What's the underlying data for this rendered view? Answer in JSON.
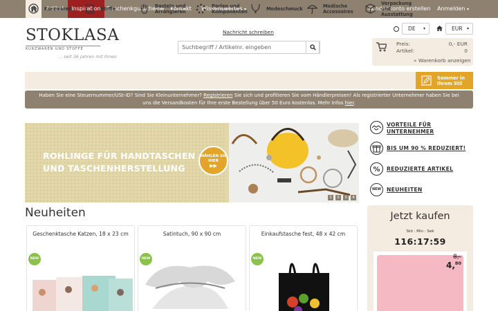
{
  "topnav": {
    "items": [
      "Artikel",
      "Inspiration",
      "Geschenkgutscheine",
      "Kontakt",
      "Wissenswertes"
    ],
    "account": "Kundenkonto erstellen",
    "login": "Anmelden"
  },
  "logo": {
    "word": "STOKLASA",
    "sub": "KURZWAREN UND STOFFE",
    "tagline": "... seit 36 Jahren mit Ihnen"
  },
  "header": {
    "message_link": "Nachricht schreiben",
    "search_placeholder": "Suchbegriff / Artikelnr. eingeben",
    "language": "DE",
    "currency": "EUR"
  },
  "cart": {
    "price_label": "Preis:",
    "price_value": "0,- EUR",
    "count_label": "Artikel:",
    "count_value": "0",
    "link": "» Warenkorb anzeigen"
  },
  "categories": [
    {
      "label": "Kurzwaren",
      "icon": "buttons-icon"
    },
    {
      "label": "Stoffe",
      "icon": "fabric-icon"
    },
    {
      "label": "Basteln und Arrangieren",
      "icon": "hand-icon"
    },
    {
      "label": "Perlen und Komponenten",
      "icon": "beads-icon"
    },
    {
      "label": "Modeschmuck",
      "icon": "necklace-icon"
    },
    {
      "label": "Modische Accessoires",
      "icon": "umbrella-icon"
    },
    {
      "label": "Verpackung und Ausstattung",
      "icon": "box-icon"
    },
    {
      "label": "Sommer in Ihrem Stil",
      "icon": "pencil-icon"
    }
  ],
  "notice": {
    "part1": "Haben Sie eine Steuernummer/USt-ID? Sind Sie Kleinunternehmer? ",
    "register": "Registrieren",
    "part2": " Sie sich und profitieren Sie vom Händlerpreisen! Als registrierter Unternehmer haben Sie bei",
    "line2": "uns die Versandkosten für Ihre erste Bestellung über 50 Euro kostenlos. Mehr Infos ",
    "here": "hier",
    "dot": "."
  },
  "banner": {
    "line1": "ROHLINGE FÜR HANDTASCHEN",
    "line2": "UND TASCHENHERSTELLUNG",
    "badge": "WÄHLEN SIE HIER",
    "badge_arrow": "▶▶",
    "pages": [
      "1",
      "2",
      "3",
      "4"
    ]
  },
  "side_links": [
    {
      "label": "VORTEILE FÜR UNTERNEHMER",
      "icon": "handshake-icon"
    },
    {
      "label": "BIS UM 90 % REDUZIERT!",
      "icon": "gift-icon"
    },
    {
      "label": "REDUZIERTE ARTIKEL",
      "icon": "percent-icon"
    },
    {
      "label": "NEUHEITEN",
      "icon": "new-icon",
      "badge": "NEW"
    }
  ],
  "neuheiten": {
    "heading": "Neuheiten",
    "new_badge": "NEW",
    "products": [
      {
        "title": "Geschenktasche Katzen, 18 x 23 cm"
      },
      {
        "title": "Satintuch, 90 x 90 cm"
      },
      {
        "title": "Einkaufstasche fest, 48 x 42 cm"
      }
    ]
  },
  "buy_now": {
    "title": "Jetzt kaufen",
    "sub": "Std : Min : Sek",
    "countdown": "116:17:59",
    "old_price": "8,-",
    "new_price_main": "4,",
    "new_price_cents": "80"
  },
  "colors": {
    "nav_bg": "#8f8170",
    "active_tab": "#9c2020",
    "cream": "#f4ece0",
    "summer": "#e3a529",
    "banner": "#e2d7aa",
    "new_badge": "#8bc34a"
  }
}
